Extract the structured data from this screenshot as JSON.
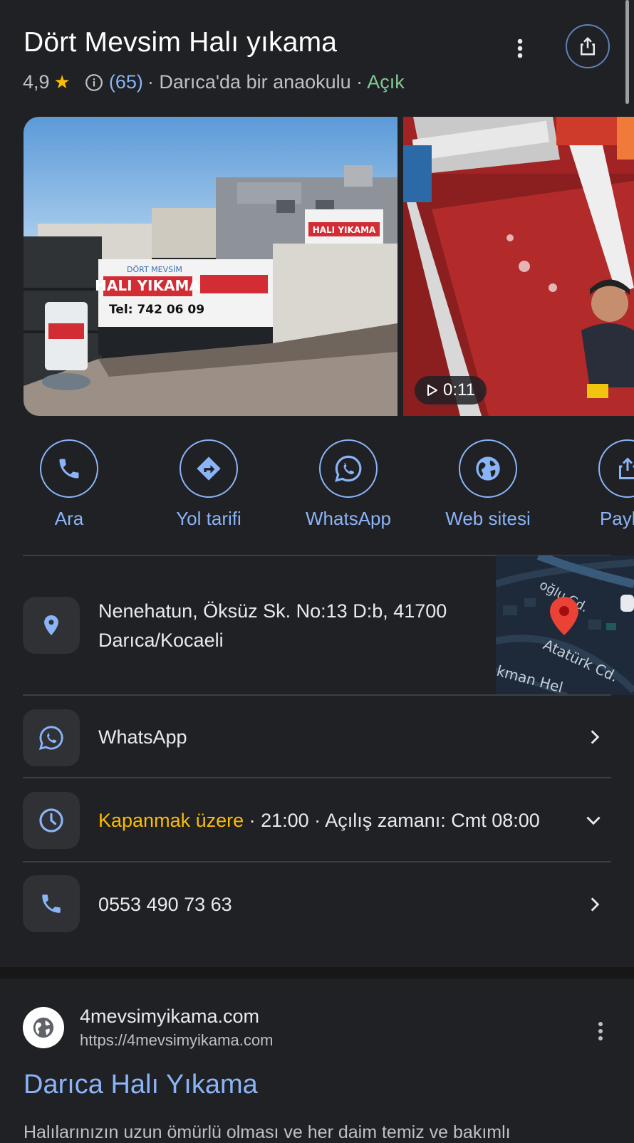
{
  "place": {
    "name": "Dört Mevsim Halı yıkama",
    "rating": "4,9",
    "review_count": "(65)",
    "category": "· Darıca'da bir anaokulu ·",
    "status": "Açık"
  },
  "media": {
    "photo1_sign_brand": "DÖRT MEVSİM",
    "photo1_sign_text": "HALI YIKAMA",
    "photo1_sign_phone": "Tel: 742 06 09",
    "video_duration": "0:11"
  },
  "actions": [
    {
      "label": "Ara",
      "icon": "phone-icon"
    },
    {
      "label": "Yol tarifi",
      "icon": "directions-icon"
    },
    {
      "label": "WhatsApp",
      "icon": "whatsapp-icon"
    },
    {
      "label": "Web sitesi",
      "icon": "globe-icon"
    },
    {
      "label": "Paylaş",
      "icon": "share-icon"
    }
  ],
  "address": {
    "line1": "Nenehatun, Öksüz Sk. No:13 D:b, 41700",
    "line2": "Darıca/Kocaeli"
  },
  "map": {
    "street1": "Atatürk Cd.",
    "street2": "oğlu Cd.",
    "street3": "kman Hel"
  },
  "whatsapp_row": {
    "label": "WhatsApp"
  },
  "hours": {
    "status": "Kapanmak üzere",
    "detail": " · 21:00 · Açılış zamanı: Cmt 08:00"
  },
  "phone_row": {
    "number": "0553 490 73 63"
  },
  "web_result": {
    "site_name": "4mevsimyikama.com",
    "url": "https://4mevsimyikama.com",
    "title": "Darıca Halı Yıkama",
    "snippet": "Halılarınızın uzun ömürlü olması ve her daim temiz ve bakımlı"
  },
  "colors": {
    "background": "#202124",
    "accent": "#8ab4f8",
    "open": "#81c995",
    "closing": "#fbbc04",
    "star": "#fbbc04"
  }
}
